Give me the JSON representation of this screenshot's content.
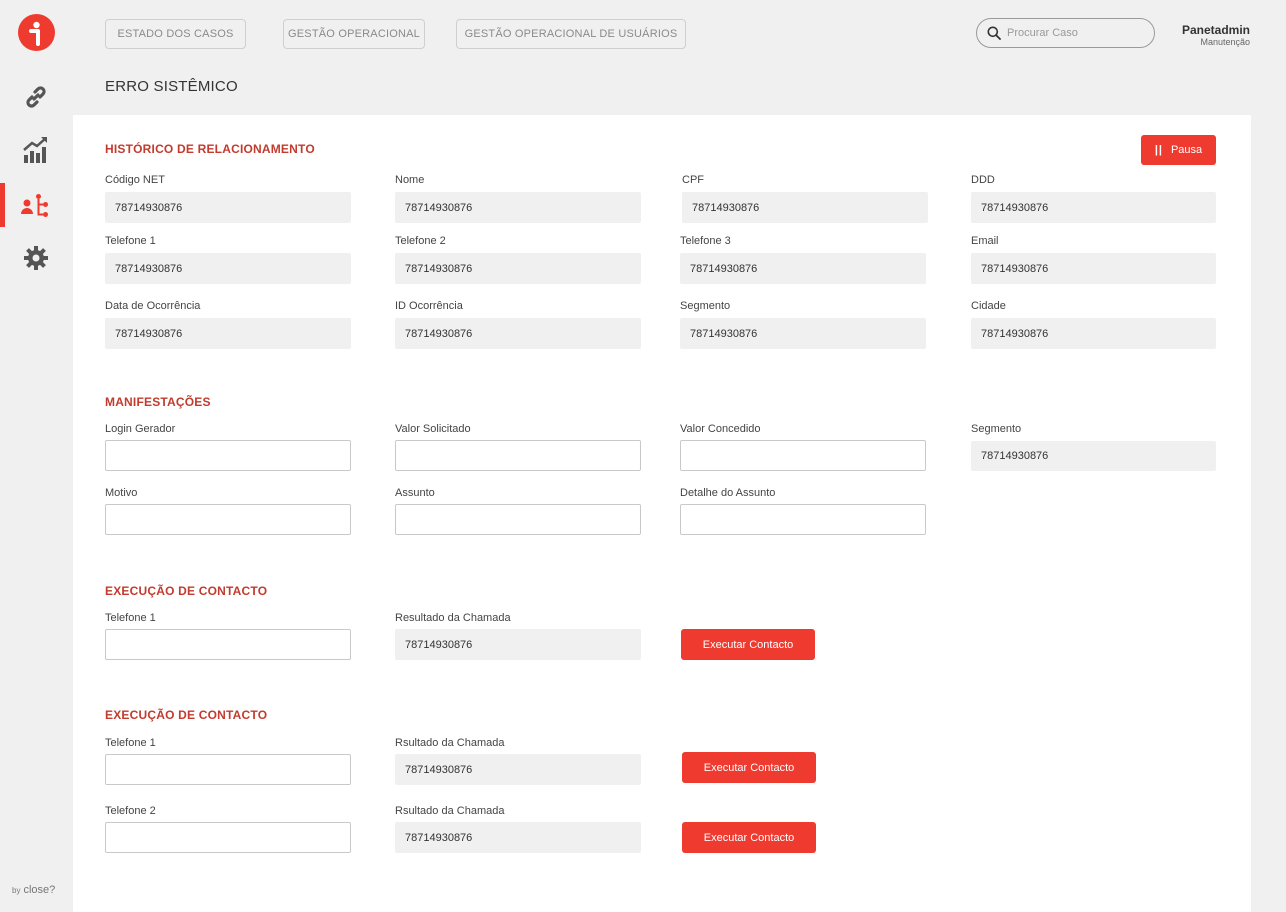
{
  "nav": {
    "tabs": [
      {
        "label": "ESTADO DOS CASOS"
      },
      {
        "label": "GESTÃO OPERACIONAL"
      },
      {
        "label": "GESTÃO OPERACIONAL DE USUÁRIOS"
      }
    ],
    "search_placeholder": "Procurar Caso",
    "user_name": "Panetadmin",
    "user_role": "Manutenção"
  },
  "sidebar": {
    "items": [
      {
        "icon": "link-icon"
      },
      {
        "icon": "chart-icon"
      },
      {
        "icon": "hierarchy-icon",
        "active": true
      },
      {
        "icon": "gear-icon"
      }
    ],
    "brand_prefix": "by",
    "brand_name": "close?"
  },
  "page_title": "ERRO SISTÊMICO",
  "historico": {
    "title": "HISTÓRICO DE RELACIONAMENTO",
    "pause_label": "Pausa",
    "fields": [
      {
        "label": "Código NET",
        "value": "78714930876"
      },
      {
        "label": "Nome",
        "value": "78714930876"
      },
      {
        "label": "CPF",
        "value": "78714930876"
      },
      {
        "label": "DDD",
        "value": "78714930876"
      },
      {
        "label": "Telefone 1",
        "value": "78714930876"
      },
      {
        "label": "Telefone 2",
        "value": "78714930876"
      },
      {
        "label": "Telefone 3",
        "value": "78714930876"
      },
      {
        "label": "Email",
        "value": "78714930876"
      },
      {
        "label": "Data de Ocorrência",
        "value": "78714930876"
      },
      {
        "label": "ID Ocorrência",
        "value": "78714930876"
      },
      {
        "label": "Segmento",
        "value": "78714930876"
      },
      {
        "label": "Cidade",
        "value": "78714930876"
      }
    ]
  },
  "manifestacoes": {
    "title": "MANIFESTAÇÕES",
    "fields": [
      {
        "label": "Login Gerador",
        "value": ""
      },
      {
        "label": "Valor Solicitado",
        "value": ""
      },
      {
        "label": "Valor Concedido",
        "value": ""
      },
      {
        "label": "Segmento",
        "value": "78714930876"
      },
      {
        "label": "Motivo",
        "value": ""
      },
      {
        "label": "Assunto",
        "value": ""
      },
      {
        "label": "Detalhe do Assunto",
        "value": ""
      }
    ]
  },
  "execucao1": {
    "title": "EXECUÇÃO DE CONTACTO",
    "phone_label": "Telefone 1",
    "phone_value": "",
    "result_label": "Resultado da Chamada",
    "result_value": "78714930876",
    "button_label": "Executar Contacto"
  },
  "execucao2": {
    "title": "EXECUÇÃO DE CONTACTO",
    "rows": [
      {
        "phone_label": "Telefone 1",
        "phone_value": "",
        "result_label": "Rsultado da Chamada",
        "result_value": "78714930876",
        "button_label": "Executar Contacto"
      },
      {
        "phone_label": "Telefone 2",
        "phone_value": "",
        "result_label": "Rsultado da Chamada",
        "result_value": "78714930876",
        "button_label": "Executar Contacto"
      }
    ]
  }
}
